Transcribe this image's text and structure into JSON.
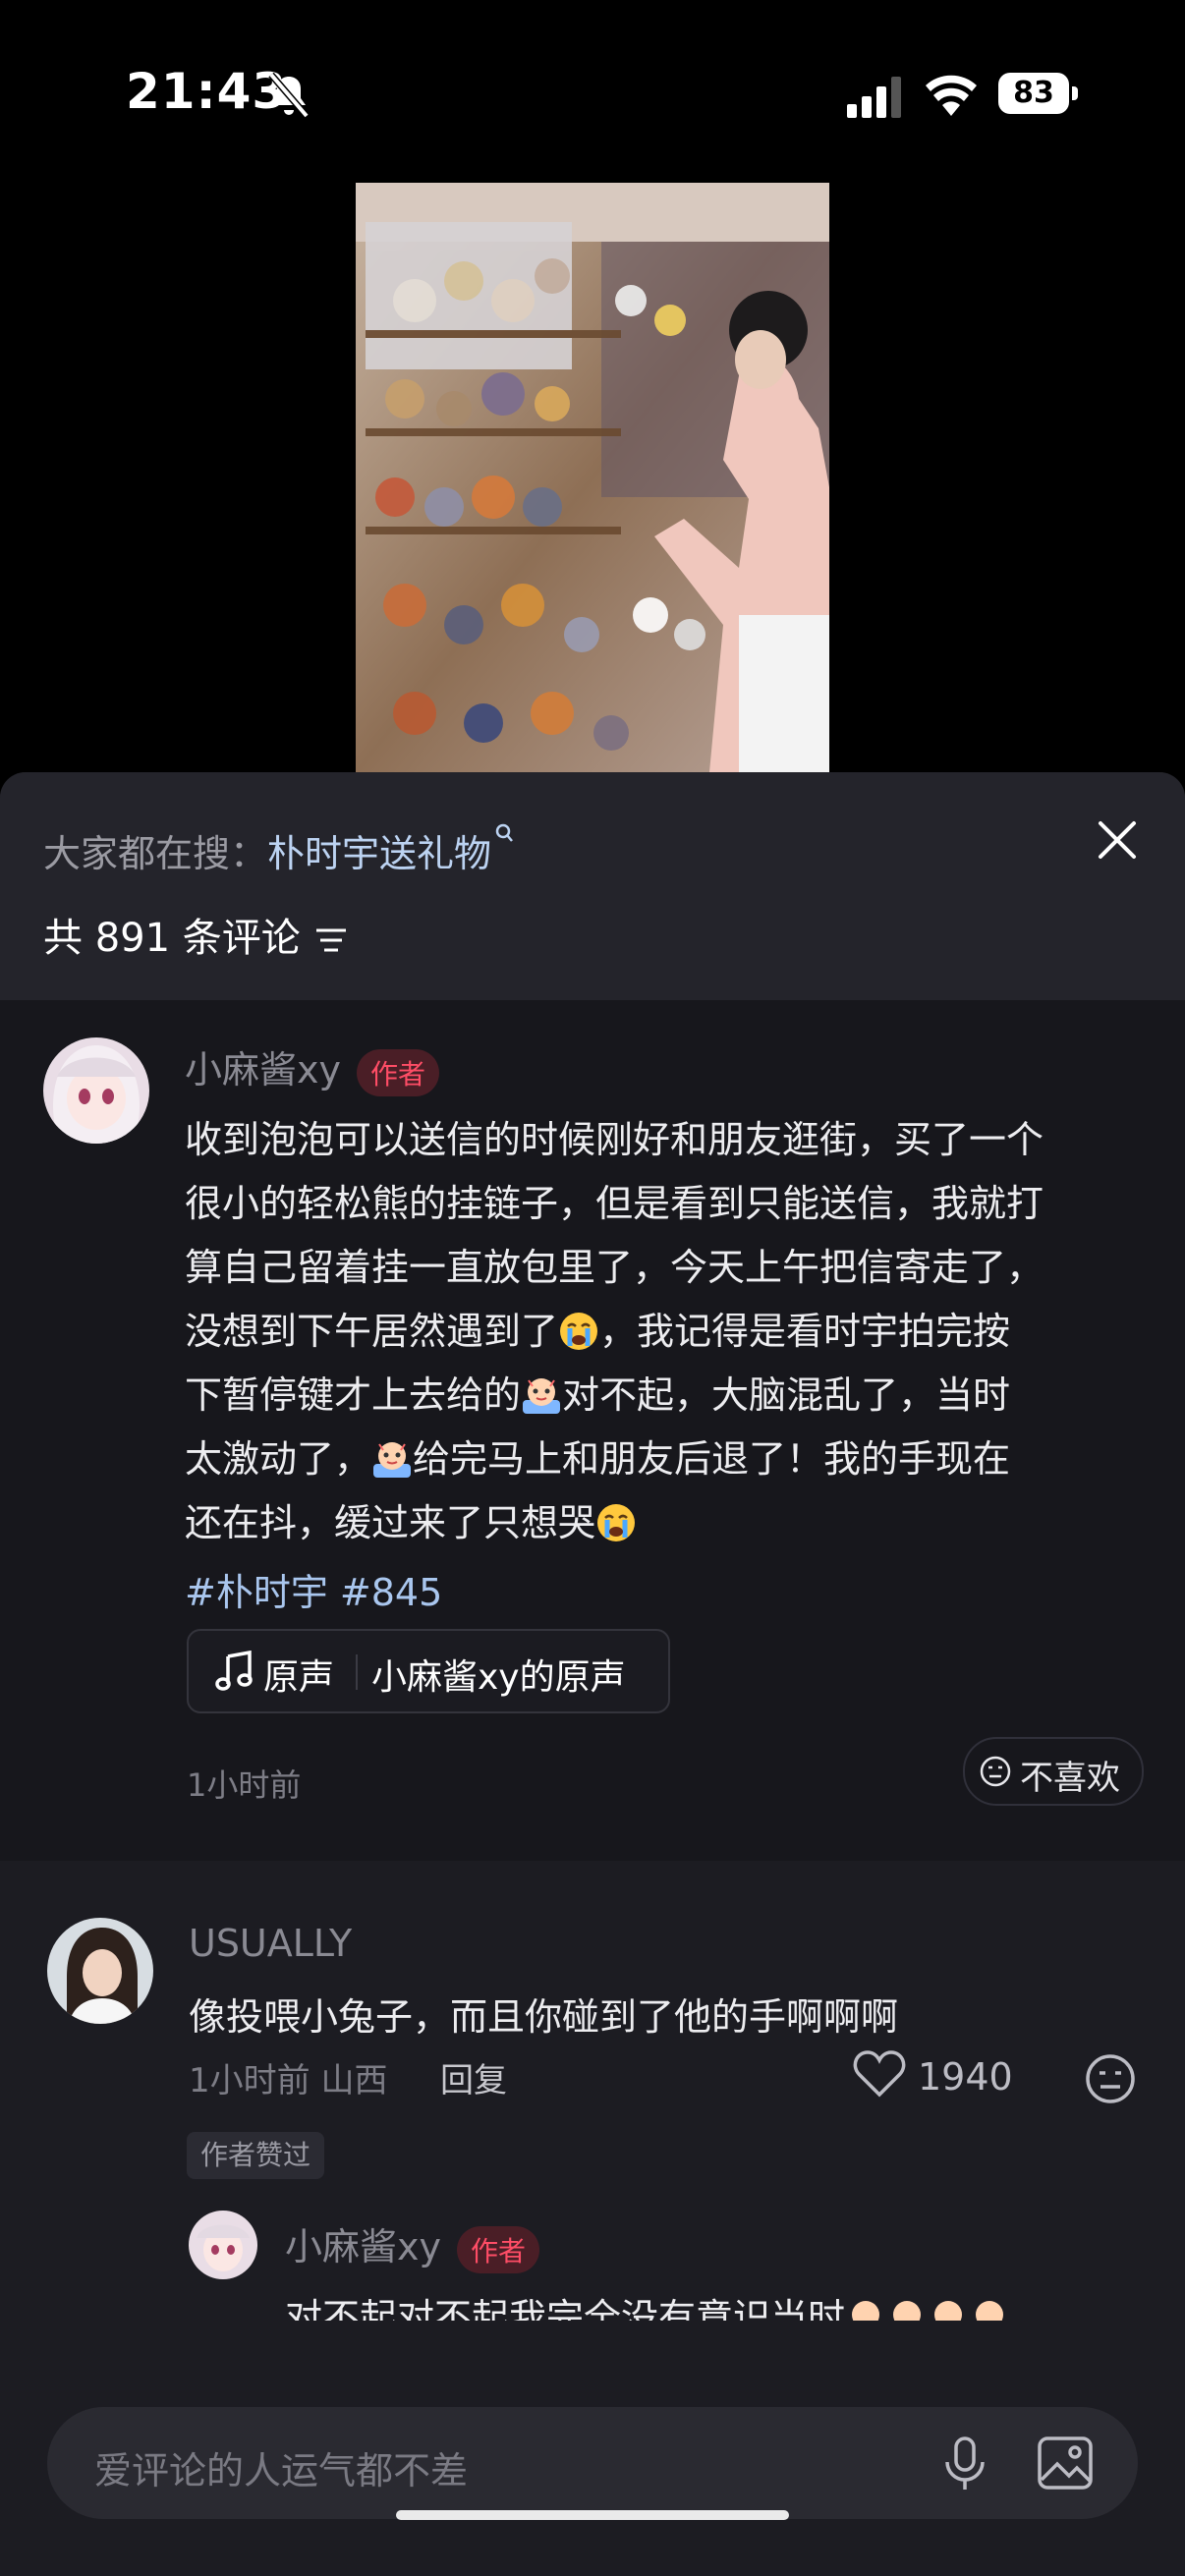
{
  "status_bar": {
    "time": "21:43",
    "battery": "83"
  },
  "trending": {
    "prefix": "大家都在搜：",
    "keyword": "朴时宇送礼物"
  },
  "comments_header": {
    "count_text": "共 891 条评论"
  },
  "post": {
    "author": "小麻酱xy",
    "author_badge": "作者",
    "text_lines": [
      "收到泡泡可以送信的时候刚好和朋友逛街，买了一个",
      "很小的轻松熊的挂链子，但是看到只能送信，我就打",
      "算自己留着挂一直放包里了，今天上午把信寄走了，",
      "没想到下午居然遇到了",
      "，我记得是看时宇拍完按",
      "下暂停键才上去给的",
      "对不起，大脑混乱了，当时",
      "太激动了，",
      "给完马上和朋友后退了！我的手现在",
      "还在抖，缓过来了只想哭"
    ],
    "hashtags": "#朴时宇 #845",
    "music_label": "原声",
    "music_name": "小麻酱xy的原声",
    "time": "1小时前",
    "dislike_label": "不喜欢"
  },
  "comment": {
    "user": "USUALLY",
    "text": "像投喂小兔子，而且你碰到了他的手啊啊啊",
    "meta": "1小时前 山西",
    "reply_label": "回复",
    "likes": "1940",
    "author_liked_tag": "作者赞过",
    "reply": {
      "user": "小麻酱xy",
      "badge": "作者",
      "text": "对不起对不起我完全没有意识当时"
    }
  },
  "input": {
    "placeholder": "爱评论的人运气都不差"
  },
  "icons": [
    "mute-bell-icon",
    "signal-icon",
    "wifi-icon",
    "battery-icon",
    "search-small-icon",
    "close-icon",
    "sort-icon",
    "music-note-icon",
    "dislike-face-icon",
    "heart-icon",
    "neutral-face-icon",
    "crying-emoji-icon",
    "mic-icon",
    "image-icon"
  ],
  "colors": {
    "badge_text": "#ff4d66",
    "link": "#a9c6ee",
    "sheet_bg": "#1c1c22"
  }
}
